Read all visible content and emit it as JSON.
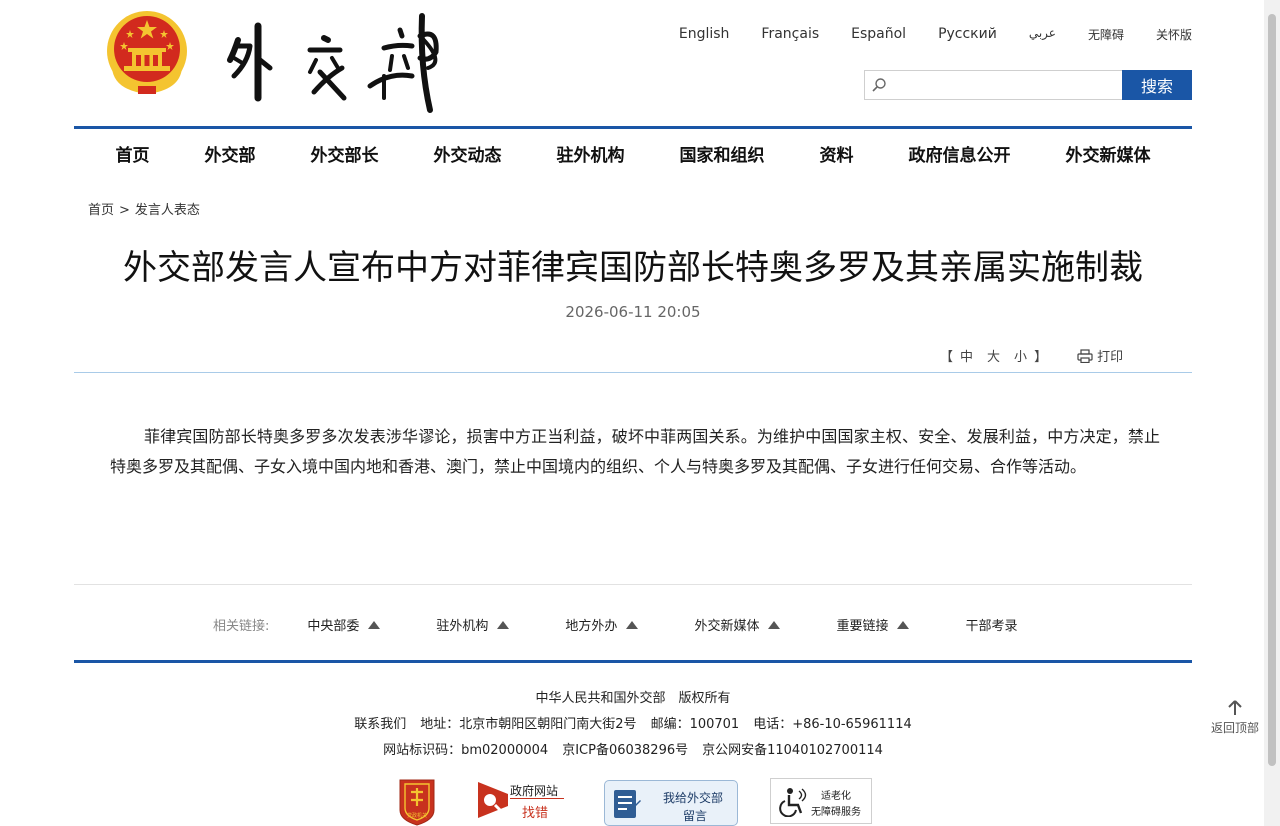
{
  "header": {
    "languages": [
      "English",
      "Français",
      "Español",
      "Русский",
      "عربي",
      "无障碍",
      "关怀版"
    ],
    "search": {
      "placeholder": "",
      "button_label": "搜索"
    }
  },
  "nav": {
    "items": [
      "首页",
      "外交部",
      "外交部长",
      "外交动态",
      "驻外机构",
      "国家和组织",
      "资料",
      "政府信息公开",
      "外交新媒体"
    ]
  },
  "breadcrumb": {
    "home": "首页",
    "separator": ">",
    "current": "发言人表态"
  },
  "article": {
    "title": "外交部发言人宣布中方对菲律宾国防部长特奥多罗及其亲属实施制裁",
    "date": "2026-06-11 20:05",
    "font_size": {
      "open": "【",
      "large": "中",
      "medium": "大",
      "small": "小",
      "close": "】"
    },
    "print_label": "打印",
    "body": "菲律宾国防部长特奥多罗多次发表涉华谬论，损害中方正当利益，破坏中菲两国关系。为维护中国国家主权、安全、发展利益，中方决定，禁止特奥多罗及其配偶、子女入境中国内地和香港、澳门，禁止中国境内的组织、个人与特奥多罗及其配偶、子女进行任何交易、合作等活动。"
  },
  "related": {
    "label": "相关链接:",
    "links": [
      "中央部委",
      "驻外机构",
      "地方外办",
      "外交新媒体",
      "重要链接",
      "干部考录"
    ]
  },
  "footer": {
    "copyright": "中华人民共和国外交部　版权所有",
    "contact": "联系我们",
    "address": "地址：北京市朝阳区朝阳门南大街2号",
    "postcode": "邮编：100701",
    "phone": "电话：+86-10-65961114",
    "site_id": "网站标识码：bm02000004",
    "icp": "京ICP备06038296号",
    "police": "京公网安备11040102700114",
    "badges": {
      "gov_site_line1": "政府网站",
      "gov_site_line2": "找错",
      "message_line1": "我给外交部",
      "message_line2": "留言",
      "aged_line1": "适老化",
      "aged_line2": "无障碍服务",
      "party_seal": "党政机关"
    }
  },
  "back_top_label": "返回顶部",
  "colors": {
    "brand_blue": "#1a56a6",
    "emblem_red": "#d22a1e",
    "emblem_gold": "#f4c430"
  }
}
